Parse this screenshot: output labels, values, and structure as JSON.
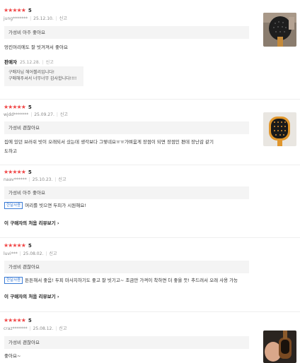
{
  "common": {
    "star_glyph": "★★★★★",
    "sep": "|"
  },
  "reviews": [
    {
      "score": "5",
      "user": "jung*******",
      "date": "25.12.10.",
      "report": "신고",
      "option": "가성비 아주 좋아요",
      "text": "엉킨머리에도 잘 빗겨져서 좋아요",
      "seller": {
        "name": "판매자",
        "date": "25.12.28.",
        "report": "신고",
        "line1": "구매자님 헤어첼리입니다!",
        "line2": "구매해주셔서 너무너무 감사합니다!!!!"
      }
    },
    {
      "score": "5",
      "user": "wjdd*******",
      "date": "25.09.27.",
      "report": "신고",
      "option": "가성비 괜찮아요",
      "text1": "집에 있던 브러쉬 빗이 오래되서 샀는데 생각보다 그렇네요ㅠㅠ가벼움게 장점이 되면 장점인 편데 장난감 같기",
      "text2": "도하고"
    },
    {
      "score": "5",
      "user": "naav******",
      "date": "25.10.23.",
      "report": "신고",
      "option": "가성비 아주 좋아요",
      "badge": "한달사용",
      "text": "머리를 빗으면 두피가 시원해요!",
      "more": "이 구매자의 처음 리뷰보기 ›"
    },
    {
      "score": "5",
      "user": "luvi***",
      "date": "25.08.02.",
      "report": "신고",
      "option": "가성비 괜찮아요",
      "badge": "한달사용",
      "text": "튼튼해서 좋음! 두피 마사지하기도 좋고 잘 빗기고~ 조금만 가격이 착하면 더 좋을 듯! 추드려서 오래 사용 가능",
      "more": "이 구매자의 처음 리뷰보기 ›"
    },
    {
      "score": "5",
      "user": "craz*******",
      "date": "25.08.12.",
      "report": "신고",
      "option": "가성비 괜찮아요",
      "text": "좋아요~"
    }
  ]
}
